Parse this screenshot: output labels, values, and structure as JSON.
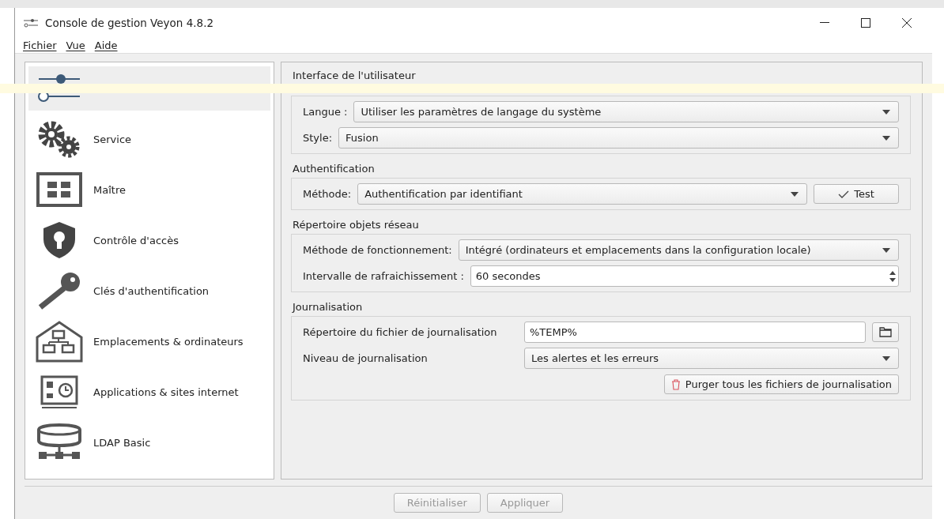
{
  "window": {
    "title": "Console de gestion Veyon 4.8.2"
  },
  "menu": [
    "Fichier",
    "Vue",
    "Aide"
  ],
  "sidebar": {
    "items": [
      {
        "selected": true
      },
      {
        "label": "Service",
        "selected": false
      },
      {
        "label": "Maître",
        "selected": false
      },
      {
        "label": "Contrôle d'accès",
        "selected": false
      },
      {
        "label": "Clés d'authentification",
        "selected": false
      },
      {
        "label": "Emplacements & ordinateurs",
        "selected": false
      },
      {
        "label": "Applications & sites internet",
        "selected": false
      },
      {
        "label": "LDAP Basic",
        "selected": false
      }
    ]
  },
  "sections": [
    {
      "title": "Interface de l'utilisateur",
      "rows": [
        {
          "kind": "combo",
          "label": "Langue :",
          "value": "Utiliser les paramètres de langage du système"
        },
        {
          "kind": "combo",
          "label": "Style:",
          "value": "Fusion"
        }
      ]
    },
    {
      "title": "Authentification",
      "rows": [
        {
          "kind": "combo",
          "label": "Méthode:",
          "value": "Authentification par identifiant",
          "button": "Test"
        }
      ]
    },
    {
      "title": "Répertoire objets réseau",
      "rows": [
        {
          "kind": "combo",
          "label": "Méthode de fonctionnement:",
          "value": "Intégré (ordinateurs et emplacements dans la configuration locale)"
        },
        {
          "kind": "spin",
          "label": "Intervalle de rafraichissement :",
          "value": "60 secondes"
        }
      ]
    },
    {
      "title": "Journalisation",
      "rows": [
        {
          "kind": "path",
          "label": "Répertoire du fichier de journalisation",
          "value": "%TEMP%"
        },
        {
          "kind": "combo",
          "label": "Niveau de journalisation",
          "value": "Les alertes et les erreurs"
        },
        {
          "kind": "action",
          "label": "Purger tous les fichiers de journalisation"
        }
      ]
    }
  ],
  "footer": [
    {
      "label": "Réinitialiser",
      "disabled": true
    },
    {
      "label": "Appliquer",
      "disabled": true
    }
  ]
}
